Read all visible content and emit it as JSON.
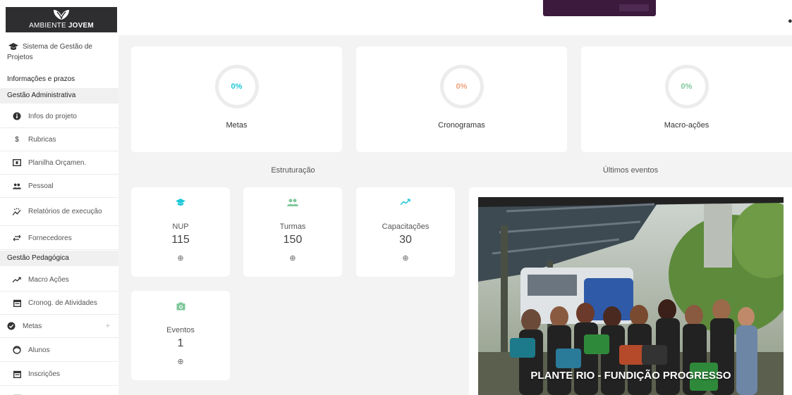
{
  "brand": {
    "logo_prefix": "AMBIENTE",
    "logo_bold": "JOVEM"
  },
  "sidebar": {
    "system_title": "Sistema de Gestão de Projetos",
    "info_section": "Informações e prazos",
    "admin_section": "Gestão Administrativa",
    "admin_items": [
      {
        "label": "Infos do projeto",
        "icon": "info-icon"
      },
      {
        "label": "Rubricas",
        "icon": "dollar-icon"
      },
      {
        "label": "Planilha Orçamen.",
        "icon": "money-icon"
      },
      {
        "label": "Pessoal",
        "icon": "people-icon"
      },
      {
        "label": "Relatórios de execução",
        "icon": "trend-dots-icon"
      },
      {
        "label": "Fornecedores",
        "icon": "swap-icon"
      }
    ],
    "pedagogic_section": "Gestão Pedagógica",
    "pedagogic_items": [
      {
        "label": "Macro Ações",
        "icon": "trend-icon"
      },
      {
        "label": "Cronog. de Atividades",
        "icon": "calendar-icon"
      },
      {
        "label": "Metas",
        "icon": "check-circle-icon",
        "expand": "+"
      },
      {
        "label": "Alunos",
        "icon": "face-icon"
      },
      {
        "label": "Inscrições",
        "icon": "calendar-icon"
      }
    ]
  },
  "stats": [
    {
      "label": "Metas",
      "value": "0%",
      "color": "#1ec8d8"
    },
    {
      "label": "Cronogramas",
      "value": "0%",
      "color": "#f0a27a"
    },
    {
      "label": "Macro-ações",
      "value": "0%",
      "color": "#7ec89a"
    }
  ],
  "sections": {
    "structure": "Estruturação",
    "events": "Últimos eventos"
  },
  "structure_cards": [
    {
      "label": "NUP",
      "value": "115",
      "add": "⊕",
      "icon": "graduation-cap-icon",
      "color": "#1ec8d8"
    },
    {
      "label": "Turmas",
      "value": "150",
      "add": "⊕",
      "icon": "people-icon",
      "color": "#7ec89a"
    },
    {
      "label": "Capacitações",
      "value": "30",
      "add": "⊕",
      "icon": "trend-icon",
      "color": "#1ec8d8"
    },
    {
      "label": "Eventos",
      "value": "1",
      "add": "⊕",
      "icon": "camera-icon",
      "color": "#7ec89a"
    }
  ],
  "event": {
    "caption": "PLANTE RIO - FUNDIÇÃO PROGRESSO"
  }
}
